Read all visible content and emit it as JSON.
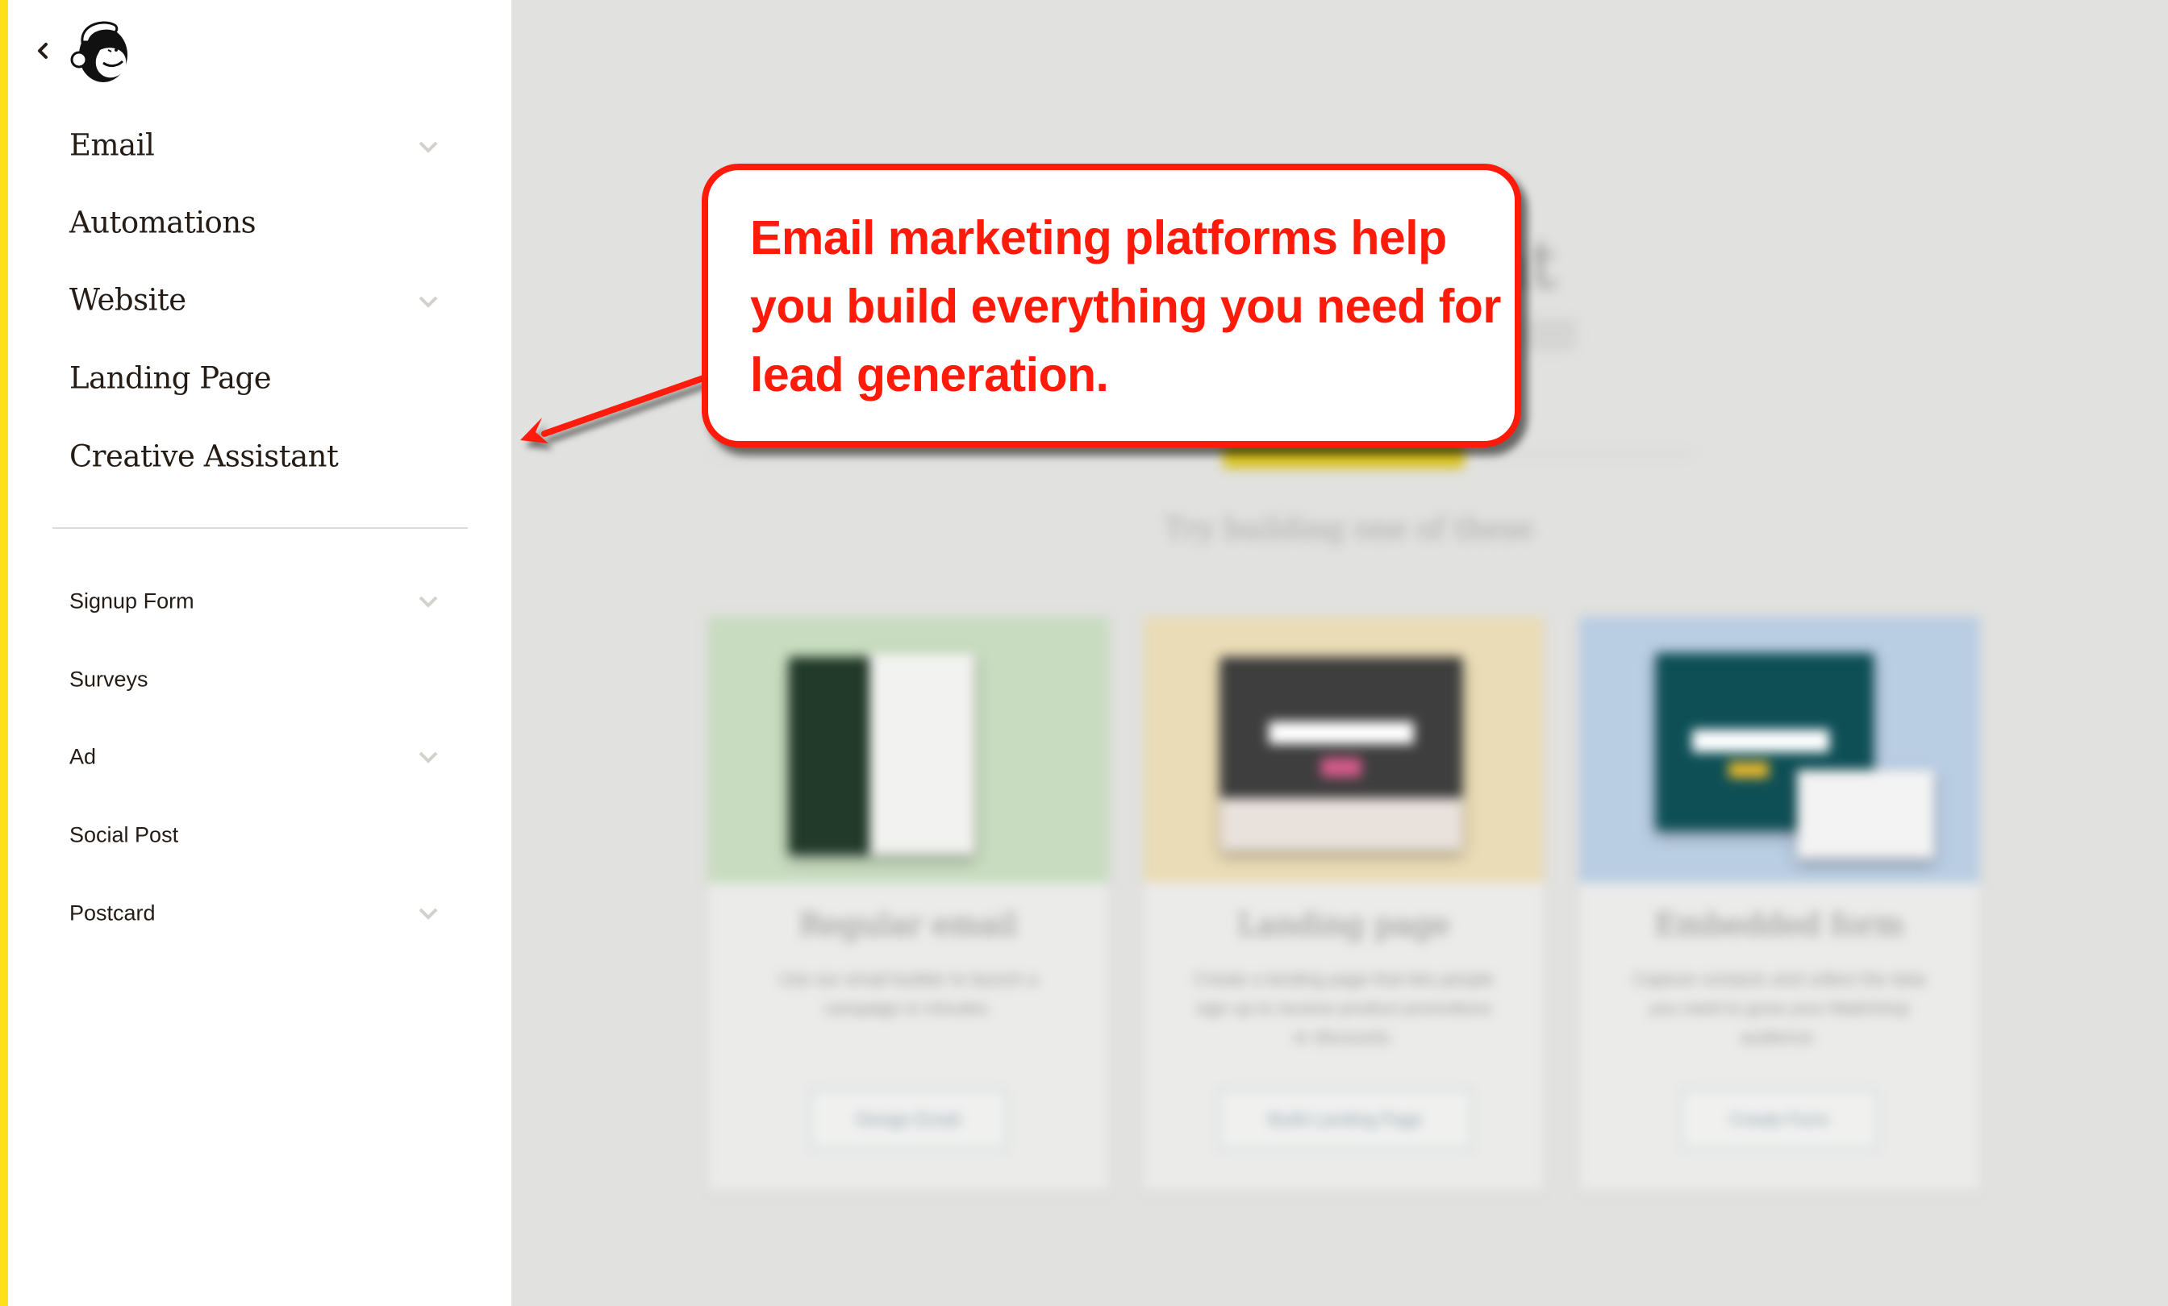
{
  "sidebar": {
    "back_label": "Back",
    "logo_alt": "Mailchimp Freddie logo",
    "primary_items": [
      {
        "label": "Email",
        "has_chevron": true
      },
      {
        "label": "Automations",
        "has_chevron": false
      },
      {
        "label": "Website",
        "has_chevron": true
      },
      {
        "label": "Landing Page",
        "has_chevron": false
      },
      {
        "label": "Creative Assistant",
        "has_chevron": false
      }
    ],
    "secondary_items": [
      {
        "label": "Signup Form",
        "has_chevron": true
      },
      {
        "label": "Surveys",
        "has_chevron": false
      },
      {
        "label": "Ad",
        "has_chevron": true
      },
      {
        "label": "Social Post",
        "has_chevron": false
      },
      {
        "label": "Postcard",
        "has_chevron": true
      }
    ]
  },
  "main": {
    "hero_title_visible": "g that",
    "cta_label": "",
    "section_label": "Try building one of these",
    "cards": [
      {
        "title": "Regular email",
        "description": "Use our email builder to launch a campaign in minutes.",
        "button": "Design Email",
        "color": "#c8dcbf"
      },
      {
        "title": "Landing page",
        "description": "Create a landing page that lets people sign up to receive product promotions or discounts.",
        "button": "Build Landing Page",
        "color": "#eadcb6"
      },
      {
        "title": "Embedded form",
        "description": "Capture contacts and collect the data you need to grow your Mailchimp audience.",
        "button": "Create Form",
        "color": "#b9cde3"
      }
    ]
  },
  "annotation": {
    "text": "Email marketing platforms help you build everything you need for lead generation.",
    "color": "#ff1a0a"
  },
  "colors": {
    "brand_yellow": "#ffe01b",
    "text_dark": "#241c15",
    "overlay_bg": "#e1e1df"
  }
}
